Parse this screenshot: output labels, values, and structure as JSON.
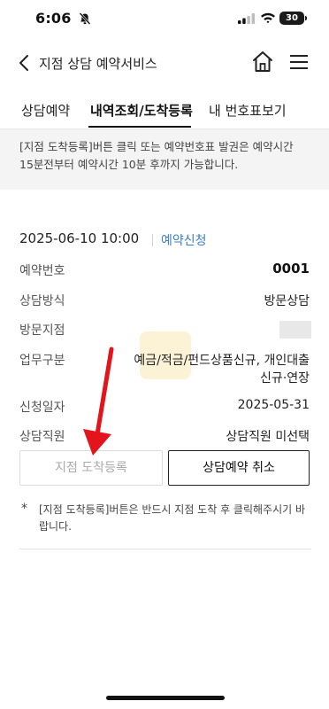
{
  "status_bar": {
    "time": "6:06",
    "battery": "30",
    "icons": [
      "bell-off-icon",
      "signal-icon",
      "wifi-icon",
      "battery-icon"
    ]
  },
  "header": {
    "title": "지점 상담 예약서비스",
    "icons": [
      "back-icon",
      "home-icon",
      "menu-icon"
    ]
  },
  "tabs": [
    {
      "label": "상담예약",
      "active": false
    },
    {
      "label": "내역조회/도착등록",
      "active": true
    },
    {
      "label": "내 번호표보기",
      "active": false
    }
  ],
  "notice": {
    "line1": "[지점 도착등록]버튼 클릭 또는 예약번호표 발권은 예약시간",
    "line2": "15분전부터 예약시간 10분 후까지 가능합니다."
  },
  "reservation": {
    "datetime": "2025-06-10 10:00",
    "status": "예약신청",
    "rows": [
      {
        "label": "예약번호",
        "value": "0001"
      },
      {
        "label": "상담방식",
        "value": "방문상담"
      },
      {
        "label": "방문지점",
        "value": ""
      },
      {
        "label": "업무구분",
        "value_line1": "예금/적금/펀드상품신규, 개인대출",
        "value_line2": "신규·연장"
      },
      {
        "label": "신청일자",
        "value": "2025-05-31"
      },
      {
        "label": "상담직원",
        "value": "상담직원 미선택"
      }
    ]
  },
  "buttons": {
    "arrive": "지점 도착등록",
    "cancel": "상담예약 취소"
  },
  "footnote": {
    "star": "*",
    "text": "[지점 도착등록]버튼은 반드시 지점 도착 후 클릭해주시기 바랍니다."
  },
  "colors": {
    "accent_link": "#3a7fc2",
    "annotation_arrow": "#e3141b",
    "notice_bg": "#f4f4f4"
  }
}
